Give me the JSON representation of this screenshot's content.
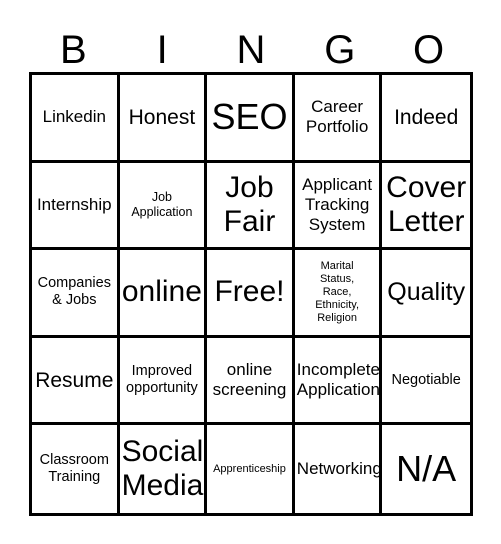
{
  "card": {
    "title": "BINGO Card",
    "header_letters": [
      "B",
      "I",
      "N",
      "G",
      "O"
    ],
    "grid": {
      "columns": 5,
      "rows": 5,
      "border_color": "#000000",
      "background_color": "#ffffff",
      "text_color": "#000000"
    },
    "cells": [
      {
        "text": "Linkedin",
        "size": "fs-md"
      },
      {
        "text": "Honest",
        "size": "fs-lg"
      },
      {
        "text": "SEO",
        "size": "fs-hero"
      },
      {
        "text": "Career\nPortfolio",
        "size": "fs-md"
      },
      {
        "text": "Indeed",
        "size": "fs-lg"
      },
      {
        "text": "Internship",
        "size": "fs-md"
      },
      {
        "text": "Job\nApplication",
        "size": "fs-xs"
      },
      {
        "text": "Job\nFair",
        "size": "fs-xxl"
      },
      {
        "text": "Applicant\nTracking\nSystem",
        "size": "fs-md"
      },
      {
        "text": "Cover\nLetter",
        "size": "fs-xxl"
      },
      {
        "text": "Companies\n& Jobs",
        "size": "fs-sm"
      },
      {
        "text": "online",
        "size": "fs-xxl"
      },
      {
        "text": "Free!",
        "size": "fs-xxl"
      },
      {
        "text": "Marital\nStatus,\nRace,\nEthnicity,\nReligion",
        "size": "fs-xxs"
      },
      {
        "text": "Quality",
        "size": "fs-xl"
      },
      {
        "text": "Resume",
        "size": "fs-lg"
      },
      {
        "text": "Improved\nopportunity",
        "size": "fs-sm"
      },
      {
        "text": "online\nscreening",
        "size": "fs-md"
      },
      {
        "text": "Incomplete\nApplication",
        "size": "fs-md"
      },
      {
        "text": "Negotiable",
        "size": "fs-sm"
      },
      {
        "text": "Classroom\nTraining",
        "size": "fs-sm"
      },
      {
        "text": "Social\nMedia",
        "size": "fs-xxl"
      },
      {
        "text": "Apprenticeship",
        "size": "fs-xxs"
      },
      {
        "text": "Networking",
        "size": "fs-md"
      },
      {
        "text": "N/A",
        "size": "fs-hero"
      }
    ],
    "free_space_index": 12
  }
}
